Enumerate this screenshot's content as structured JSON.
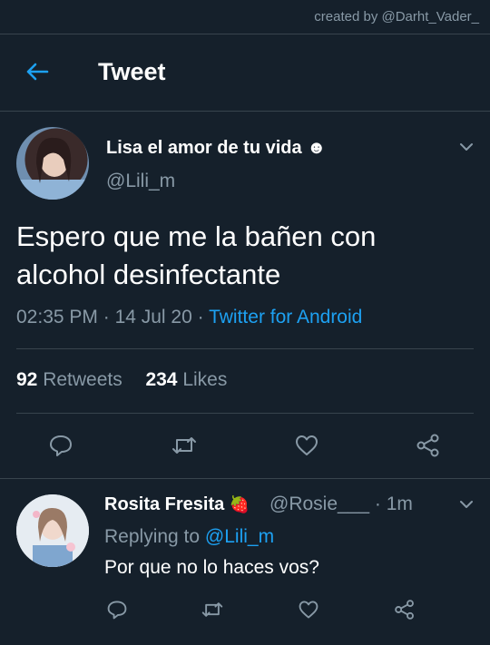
{
  "watermark": "created by @Darht_Vader_",
  "header": {
    "title": "Tweet"
  },
  "tweet": {
    "author_name": "Lisa el amor de tu vida",
    "author_emoji": "☻",
    "handle": "@Lili_m",
    "text": "Espero que me la bañen con alcohol desinfectante",
    "time": "02:35 PM",
    "date": "14 Jul 20",
    "source": "Twitter for Android",
    "retweets_count": "92",
    "retweets_label": "Retweets",
    "likes_count": "234",
    "likes_label": "Likes"
  },
  "reply": {
    "author_name": "Rosita Fresita",
    "author_emoji": "🍓",
    "handle": "@Rosie___",
    "time": "1m",
    "replying_label": "Replying to",
    "replying_to": "@Lili_m",
    "text": "Por que no lo haces vos?"
  },
  "colors": {
    "background": "#15202b",
    "accent": "#1da1f2",
    "muted": "#8899a6",
    "divider": "#38444d"
  },
  "icons": [
    "back-arrow-icon",
    "chevron-down-icon",
    "reply-icon",
    "retweet-icon",
    "like-icon",
    "share-icon"
  ]
}
